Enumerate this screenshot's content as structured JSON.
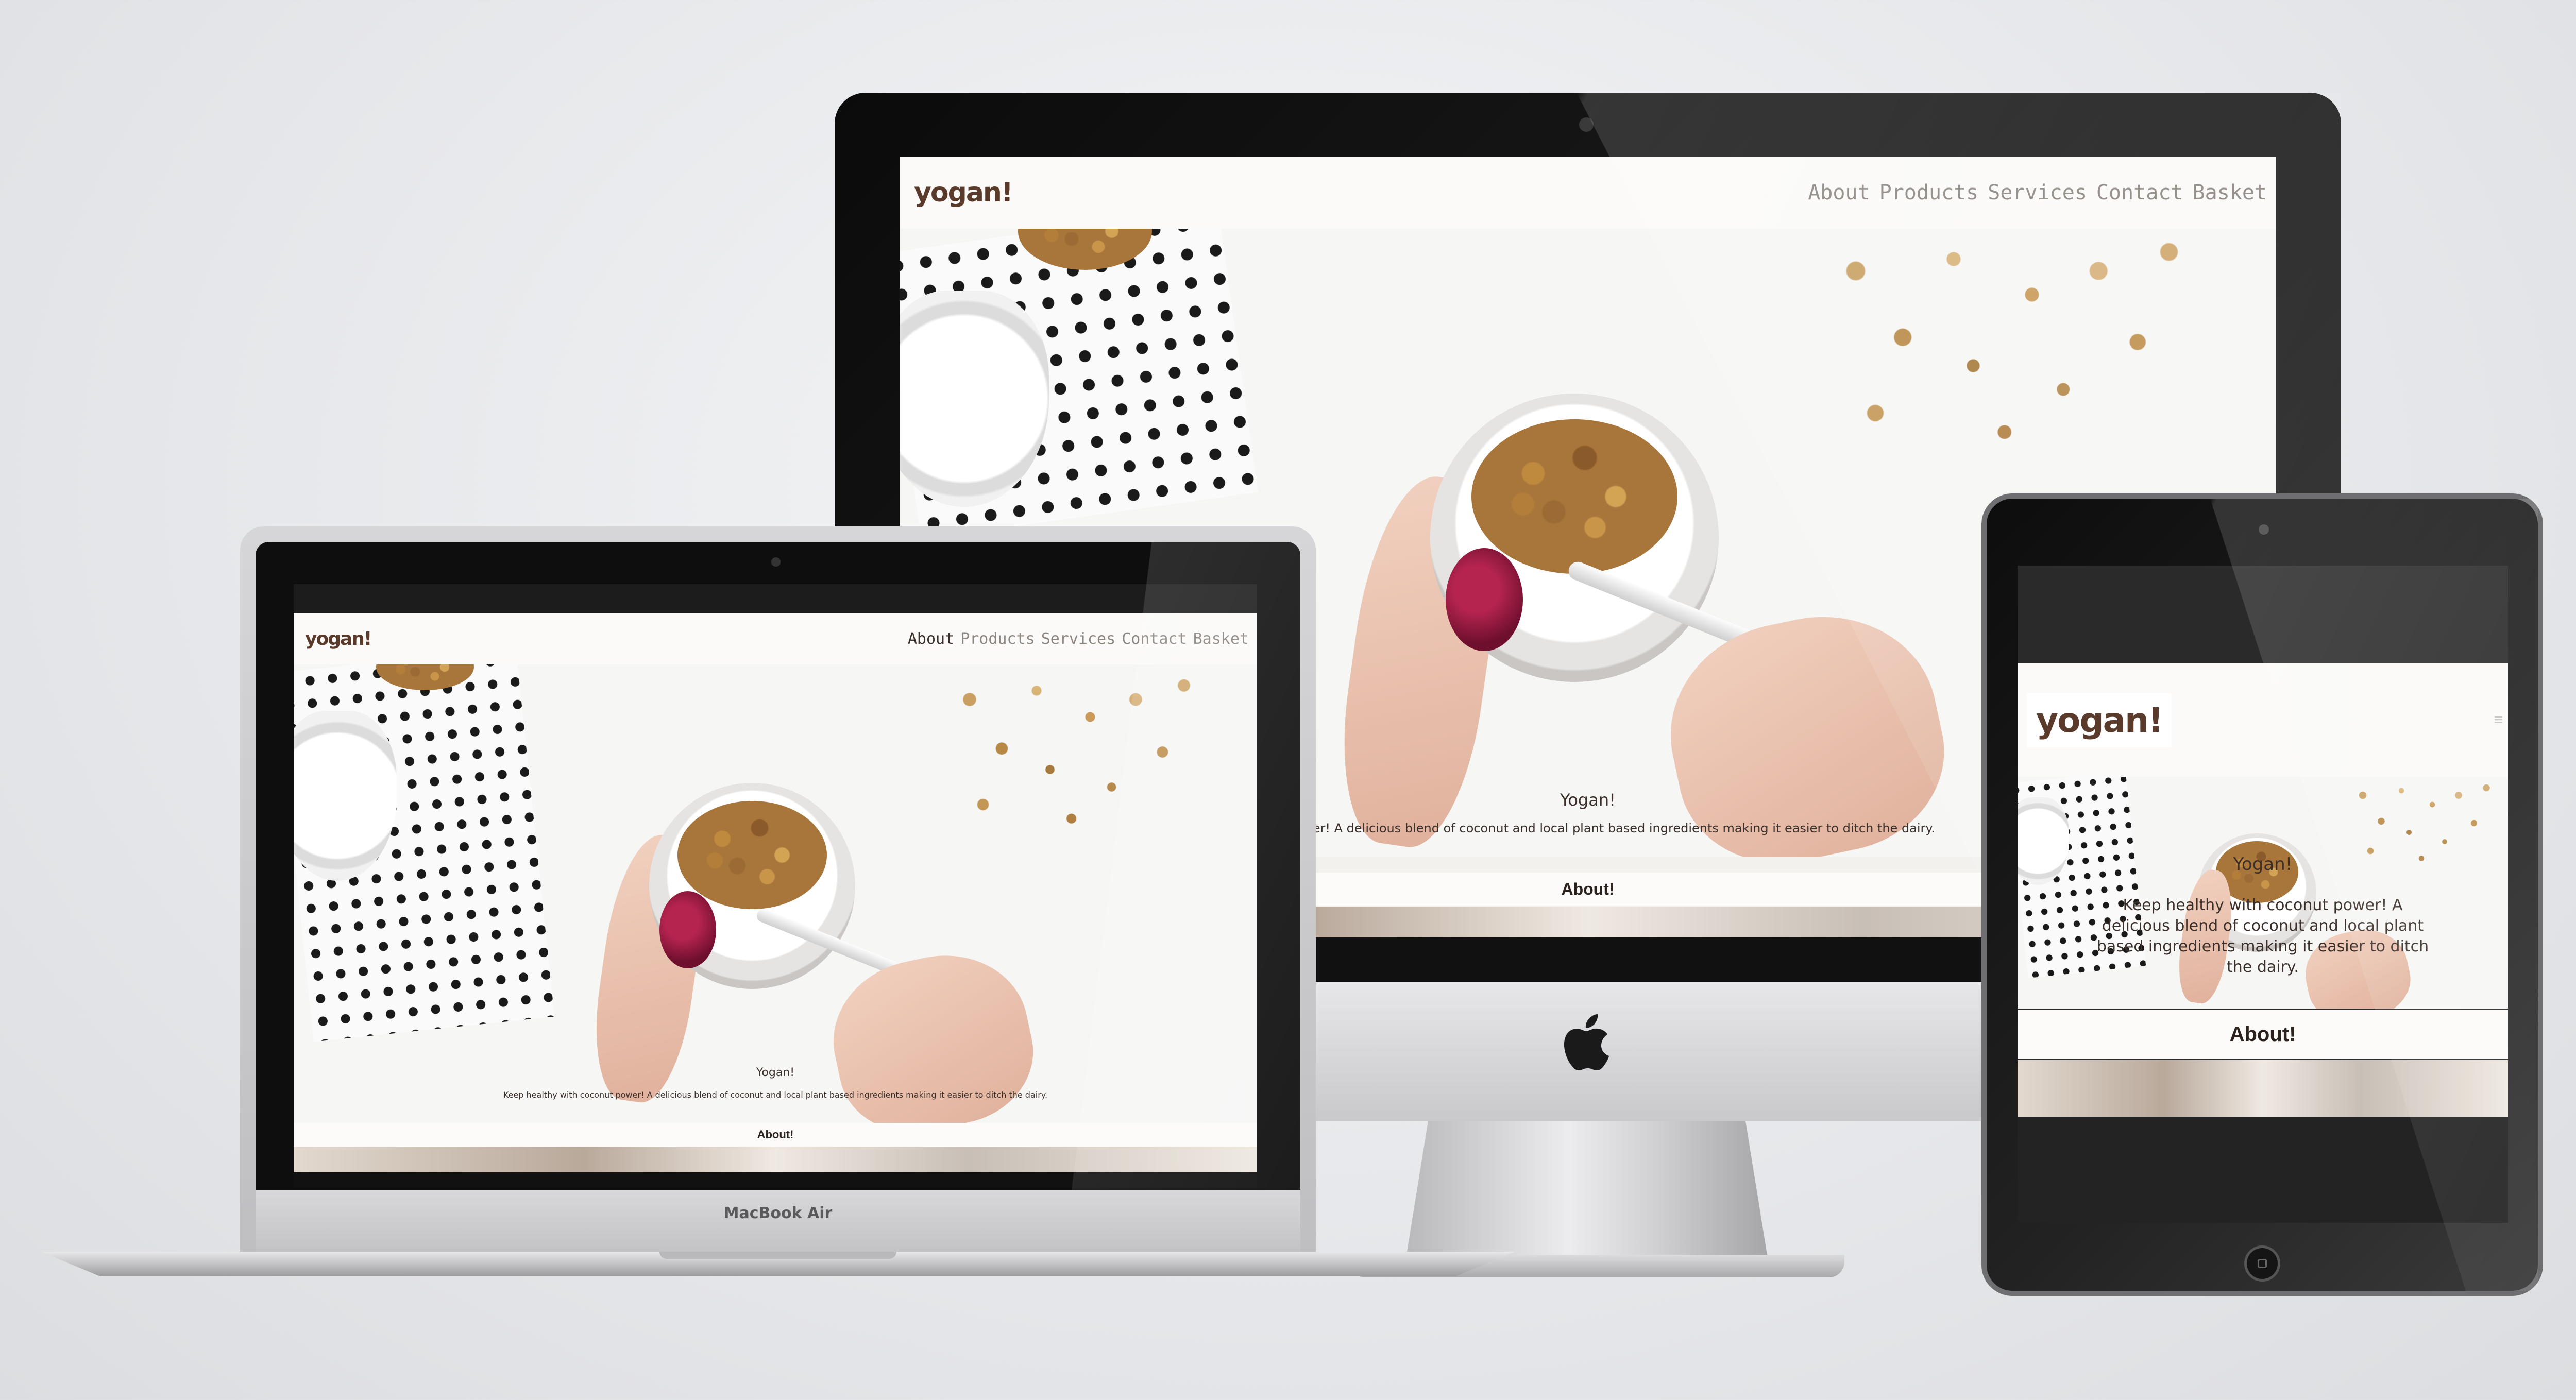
{
  "site": {
    "logo": "yogan!",
    "nav": [
      "About",
      "Products",
      "Services",
      "Contact",
      "Basket"
    ],
    "hero_title": "Yogan!",
    "hero_tagline": "Keep healthy with coconut power! A delicious blend of coconut and local plant based ingredients making it easier to ditch the dairy.",
    "imac_hero_tagline": "oconut power! A delicious blend of coconut and local plant based ingredients making it easier to ditch the dairy.",
    "ipad_hero_title": "Yogan!",
    "ipad_hero_tagline": "Keep healthy with coconut power! A delicious blend of coconut and local plant based ingredients making it easier to ditch the dairy.",
    "about_label": "About!",
    "menu_icon_glyph": "≡"
  },
  "devices": {
    "laptop_label": "MacBook Air",
    "apple_logo_icon": "apple-logo-icon"
  },
  "colors": {
    "brand_brown": "#5a3a2b",
    "nav_grey": "#8c8580",
    "page_bg": "#f3f1ee"
  }
}
